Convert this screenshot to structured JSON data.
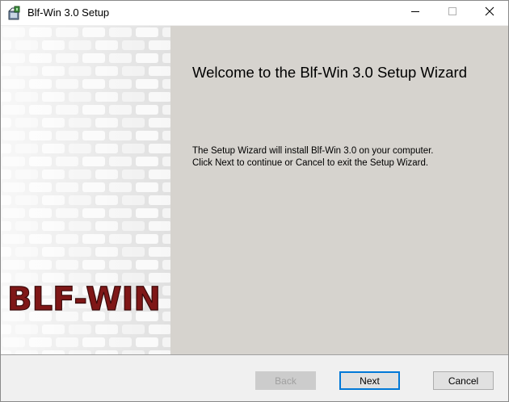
{
  "window": {
    "title": "Blf-Win 3.0 Setup",
    "icons": {
      "app": "installer-package-icon",
      "minimize": "minimize-icon",
      "maximize": "maximize-icon",
      "close": "close-icon"
    }
  },
  "banner": {
    "logo_text": "BLF-WIN",
    "logo_color": "#8b1a1a"
  },
  "content": {
    "title": "Welcome to the Blf-Win 3.0 Setup Wizard",
    "body_lines": [
      "The Setup Wizard will install Blf-Win 3.0 on your computer.",
      "Click Next to continue or Cancel to exit the Setup Wizard."
    ]
  },
  "buttons": {
    "back": "Back",
    "next": "Next",
    "cancel": "Cancel"
  },
  "colors": {
    "content_background": "#d6d3ce",
    "accent": "#0078d7"
  }
}
